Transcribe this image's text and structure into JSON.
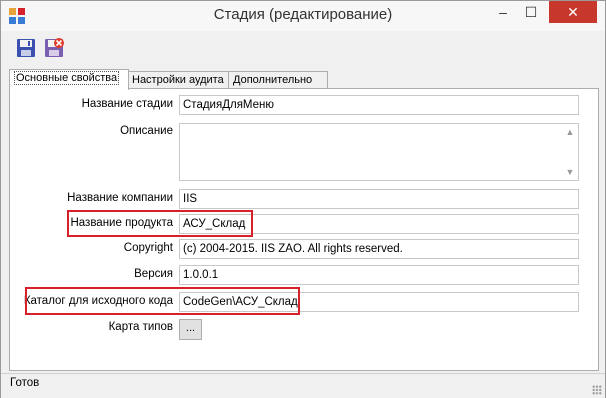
{
  "window": {
    "title": "Стадия (редактирование)",
    "minimize_glyph": "–",
    "maximize_glyph": "☐",
    "close_glyph": "✕"
  },
  "toolbar": {
    "save_icon": "floppy-save-icon",
    "save_close_icon": "floppy-save-close-icon"
  },
  "tabs": [
    {
      "label": "Основные свойства",
      "active": true
    },
    {
      "label": "Настройки аудита",
      "active": false
    },
    {
      "label": "Дополнительно",
      "active": false
    }
  ],
  "form": {
    "stage_name": {
      "label": "Название стадии",
      "value": "СтадияДляМеню"
    },
    "description": {
      "label": "Описание",
      "value": ""
    },
    "company_name": {
      "label": "Название компании",
      "value": "IIS"
    },
    "product_name": {
      "label": "Название продукта",
      "value": "АСУ_Склад"
    },
    "copyright": {
      "label": "Copyright",
      "value": "(c) 2004-2015. IIS ZAO. All rights reserved."
    },
    "version": {
      "label": "Версия",
      "value": "1.0.0.1"
    },
    "source_dir": {
      "label": "Каталог для исходного кода",
      "value": "CodeGen\\АСУ_Склад"
    },
    "type_map": {
      "label": "Карта типов",
      "button": "..."
    }
  },
  "status": {
    "text": "Готов"
  },
  "colors": {
    "highlight": "#d6202a",
    "close_button": "#c7372c"
  }
}
